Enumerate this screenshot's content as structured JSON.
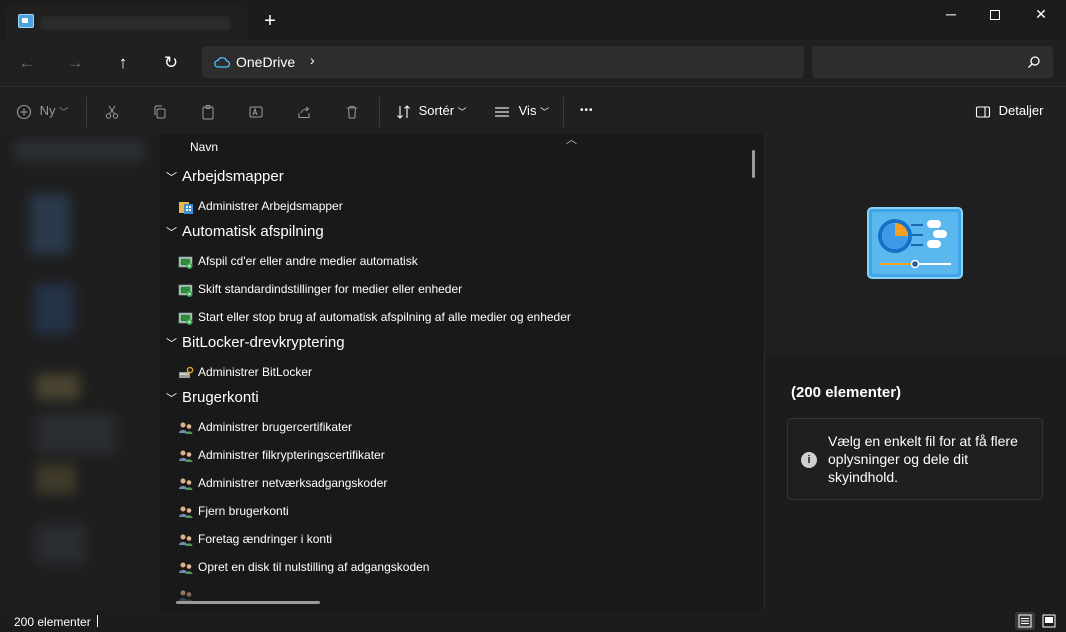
{
  "titlebar": {
    "new_tab_label": "+",
    "minimize_label": "─",
    "close_label": "✕"
  },
  "nav": {
    "back_label": "←",
    "forward_label": "→",
    "up_label": "↑",
    "refresh_label": "↻"
  },
  "address": {
    "location": "OneDrive",
    "chevron": "›"
  },
  "commandbar": {
    "new_label": "Ny",
    "sort_label": "Sortér",
    "view_label": "Vis",
    "more_label": "•••",
    "details_label": "Detaljer"
  },
  "list": {
    "column_name": "Navn",
    "groups": [
      {
        "title": "Arbejdsmapper",
        "items": [
          {
            "label": "Administrer Arbejdsmapper",
            "icon": "workfolders-icon"
          }
        ]
      },
      {
        "title": "Automatisk afspilning",
        "items": [
          {
            "label": "Afspil cd'er eller andre medier automatisk",
            "icon": "autoplay-icon"
          },
          {
            "label": "Skift standardindstillinger for medier eller enheder",
            "icon": "autoplay-icon"
          },
          {
            "label": "Start eller stop brug af automatisk afspilning af alle medier og enheder",
            "icon": "autoplay-icon"
          }
        ]
      },
      {
        "title": "BitLocker-drevkryptering",
        "items": [
          {
            "label": "Administrer BitLocker",
            "icon": "bitlocker-icon"
          }
        ]
      },
      {
        "title": "Brugerkonti",
        "items": [
          {
            "label": "Administrer brugercertifikater",
            "icon": "users-icon"
          },
          {
            "label": "Administrer filkrypteringscertifikater",
            "icon": "users-icon"
          },
          {
            "label": "Administrer netværksadgangskoder",
            "icon": "users-icon"
          },
          {
            "label": "Fjern brugerkonti",
            "icon": "users-icon"
          },
          {
            "label": "Foretag ændringer i konti",
            "icon": "users-icon"
          },
          {
            "label": "Opret en disk til nulstilling af adgangskoden",
            "icon": "users-icon"
          }
        ]
      }
    ]
  },
  "details": {
    "count": "(200 elementer)",
    "info": "Vælg en enkelt fil for at få flere oplysninger og dele dit skyindhold."
  },
  "status": {
    "count": "200 elementer"
  },
  "colors": {
    "accent": "#4cc2ff",
    "background": "#1c1c1c"
  }
}
